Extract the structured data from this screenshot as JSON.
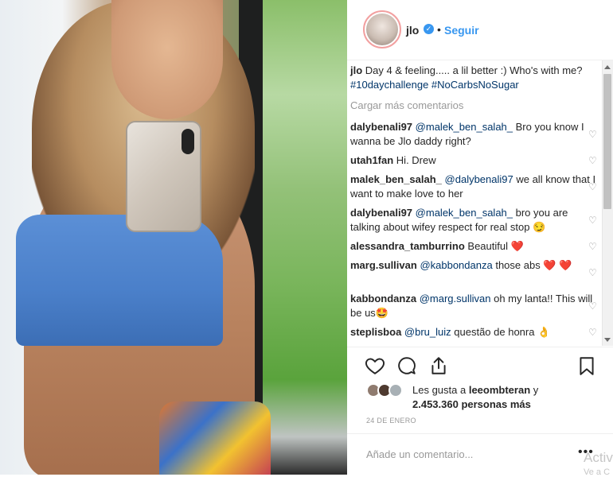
{
  "post": {
    "username": "jlo",
    "follow_label": "Seguir",
    "caption_user": "jlo",
    "caption_text": "Day 4 & feeling..... a lil better :) Who's with me?",
    "caption_tags": "#10daychallenge #NoCarbsNoSugar",
    "load_more": "Cargar más comentarios",
    "comments": [
      {
        "user": "dalybenali97",
        "mention": "@malek_ben_salah_",
        "text": " Bro you know I wanna be Jlo daddy right?"
      },
      {
        "user": "utah1fan",
        "mention": "",
        "text": "Hi. Drew"
      },
      {
        "user": "malek_ben_salah_",
        "mention": "@dalybenali97",
        "text": " we all know that I want to make love to her"
      },
      {
        "user": "dalybenali97",
        "mention": "@malek_ben_salah_",
        "text": " bro you are talking about wifey respect for real stop 😏"
      },
      {
        "user": "alessandra_tamburrino",
        "mention": "",
        "text": "Beautiful ❤️"
      },
      {
        "user": "marg.sullivan",
        "mention": "@kabbondanza",
        "text": " those abs ❤️ ❤️"
      },
      {
        "user": "kabbondanza",
        "mention": "@marg.sullivan",
        "text": " oh my lanta!! This will be us🤩"
      },
      {
        "user": "steplisboa",
        "mention": "@bru_luiz",
        "text": " questão de honra 👌"
      }
    ],
    "likes_prefix": "Les gusta a",
    "likes_user": "leeombteran",
    "likes_mid": " y",
    "likes_count": "2.453.360 personas más",
    "date": "24 DE ENERO",
    "add_comment_placeholder": "Añade un comentario...",
    "more_dots": "•••",
    "watermark_line1": "Activ",
    "watermark_line2": "Ve a C"
  },
  "icons": {
    "verified": "verified-badge-icon",
    "like": "heart-outline-icon",
    "comment": "comment-bubble-icon",
    "share": "share-upload-icon",
    "save": "bookmark-icon",
    "comment_like": "small-heart-icon"
  },
  "colors": {
    "link": "#3897f0",
    "mention": "#003569",
    "muted": "#999999",
    "text": "#262626",
    "heart_red": "#ed4956"
  }
}
